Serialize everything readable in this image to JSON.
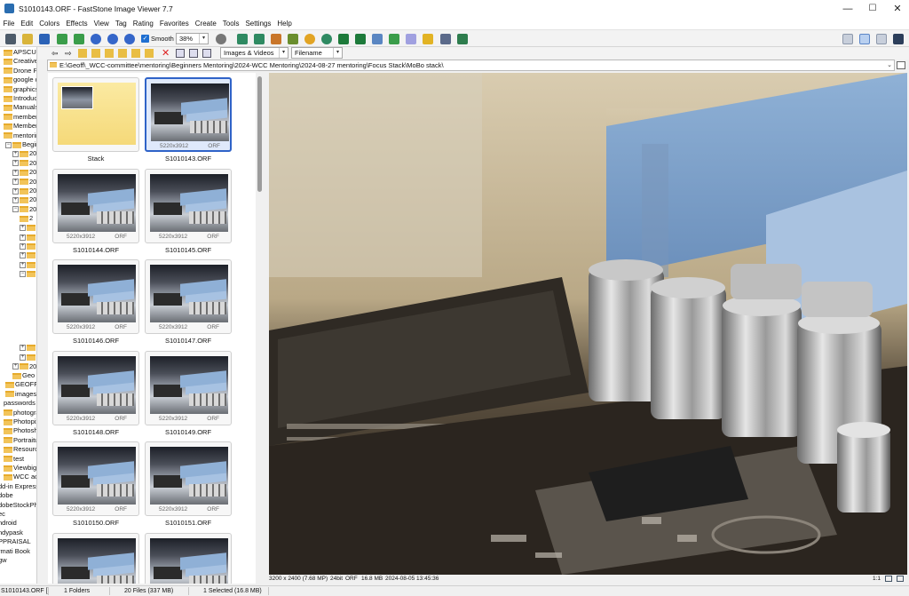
{
  "window": {
    "title": "S1010143.ORF  -  FastStone Image Viewer 7.7",
    "controls": [
      "—",
      "☐",
      "✕"
    ]
  },
  "menu": [
    "File",
    "Edit",
    "Colors",
    "Effects",
    "View",
    "Tag",
    "Rating",
    "Favorites",
    "Create",
    "Tools",
    "Settings",
    "Help"
  ],
  "toolbar": {
    "smooth_label": "Smooth",
    "zoom": "38%",
    "filter": "Images & Videos",
    "sort": "Filename"
  },
  "path": "E:\\Geoff\\_WCC-committee\\mentoring\\Beginners Mentoring\\2024-WCC Mentoring\\2024-08-27 mentoring\\Focus Stack\\MoBo stack\\",
  "tree": [
    {
      "label": "APSCUP201",
      "depth": 0,
      "expander": "",
      "folder": true
    },
    {
      "label": "Creative - C",
      "depth": 0,
      "expander": "",
      "folder": true
    },
    {
      "label": "Drone Perm",
      "depth": 0,
      "expander": "",
      "folder": true
    },
    {
      "label": "google driv",
      "depth": 0,
      "expander": "",
      "folder": true
    },
    {
      "label": "graphics",
      "depth": 0,
      "expander": "",
      "folder": true
    },
    {
      "label": "Introductor",
      "depth": 0,
      "expander": "",
      "folder": true
    },
    {
      "label": "Manuals an",
      "depth": 0,
      "expander": "",
      "folder": true
    },
    {
      "label": "membershi",
      "depth": 0,
      "expander": "",
      "folder": true
    },
    {
      "label": "Membershi",
      "depth": 0,
      "expander": "",
      "folder": true
    },
    {
      "label": "mentoring",
      "depth": 0,
      "expander": "",
      "folder": true
    },
    {
      "label": "Beginne",
      "depth": 1,
      "expander": "−",
      "folder": true
    },
    {
      "label": "2021",
      "depth": 2,
      "expander": "+",
      "folder": true
    },
    {
      "label": "2022",
      "depth": 2,
      "expander": "+",
      "folder": true
    },
    {
      "label": "2023",
      "depth": 2,
      "expander": "+",
      "folder": true
    },
    {
      "label": "2023",
      "depth": 2,
      "expander": "+",
      "folder": true
    },
    {
      "label": "2023",
      "depth": 2,
      "expander": "+",
      "folder": true
    },
    {
      "label": "2023",
      "depth": 2,
      "expander": "+",
      "folder": true
    },
    {
      "label": "2024",
      "depth": 2,
      "expander": "−",
      "folder": true
    },
    {
      "label": "2",
      "depth": 3,
      "expander": "",
      "folder": true
    },
    {
      "label": "2",
      "depth": 3,
      "expander": "+",
      "folder": true
    },
    {
      "label": "2",
      "depth": 3,
      "expander": "+",
      "folder": true
    },
    {
      "label": "2",
      "depth": 3,
      "expander": "+",
      "folder": true
    },
    {
      "label": "2",
      "depth": 3,
      "expander": "+",
      "folder": true
    },
    {
      "label": "2",
      "depth": 3,
      "expander": "+",
      "folder": true
    },
    {
      "label": "2",
      "depth": 3,
      "expander": "−",
      "folder": true
    },
    {
      "label": "",
      "depth": 4,
      "expander": "",
      "folder": false
    },
    {
      "label": "",
      "depth": 4,
      "expander": "",
      "folder": false
    },
    {
      "label": "",
      "depth": 4,
      "expander": "",
      "folder": false
    },
    {
      "label": "",
      "depth": 4,
      "expander": "",
      "folder": false
    },
    {
      "label": "",
      "depth": 4,
      "expander": "",
      "folder": false
    },
    {
      "label": "",
      "depth": 4,
      "expander": "",
      "folder": false
    },
    {
      "label": "",
      "depth": 4,
      "expander": "",
      "folder": false
    },
    {
      "label": "2",
      "depth": 3,
      "expander": "+",
      "folder": true
    },
    {
      "label": "2",
      "depth": 3,
      "expander": "+",
      "folder": true
    },
    {
      "label": "2025",
      "depth": 2,
      "expander": "+",
      "folder": true
    },
    {
      "label": "Geo",
      "depth": 2,
      "expander": "",
      "folder": true
    },
    {
      "label": "GEOFF I",
      "depth": 1,
      "expander": "",
      "folder": true
    },
    {
      "label": "images",
      "depth": 1,
      "expander": "",
      "folder": true
    },
    {
      "label": "passwords",
      "depth": 0,
      "expander": "",
      "folder": false
    },
    {
      "label": "photograph",
      "depth": 0,
      "expander": "",
      "folder": true
    },
    {
      "label": "Photopix",
      "depth": 0,
      "expander": "",
      "folder": true
    },
    {
      "label": "Photoshop",
      "depth": 0,
      "expander": "",
      "folder": true
    },
    {
      "label": "Portraiture",
      "depth": 0,
      "expander": "",
      "folder": true
    },
    {
      "label": "Resources.v",
      "depth": 0,
      "expander": "",
      "folder": true
    },
    {
      "label": "test",
      "depth": 0,
      "expander": "",
      "folder": true
    },
    {
      "label": "Viewbig cha",
      "depth": 0,
      "expander": "",
      "folder": true
    },
    {
      "label": "WCC activit",
      "depth": 0,
      "expander": "",
      "folder": true
    },
    {
      "label": "dd-in Express",
      "depth": -1,
      "expander": "",
      "folder": false
    },
    {
      "label": "dobe",
      "depth": -1,
      "expander": "",
      "folder": false
    },
    {
      "label": "dobeStockPh",
      "depth": -1,
      "expander": "",
      "folder": false
    },
    {
      "label": "ec",
      "depth": -1,
      "expander": "",
      "folder": false
    },
    {
      "label": "ndroid",
      "depth": -1,
      "expander": "",
      "folder": false
    },
    {
      "label": "ndypask",
      "depth": -1,
      "expander": "",
      "folder": false
    },
    {
      "label": "PPRAISAL",
      "depth": -1,
      "expander": "",
      "folder": false
    },
    {
      "label": "rmati Book",
      "depth": -1,
      "expander": "",
      "folder": false
    },
    {
      "label": "gw",
      "depth": -1,
      "expander": "",
      "folder": false
    }
  ],
  "thumbnails": [
    {
      "name": "Stack",
      "dims": "",
      "ext": "",
      "stack": true,
      "selected": false
    },
    {
      "name": "S1010143.ORF",
      "dims": "5220x3912",
      "ext": "ORF",
      "stack": false,
      "selected": true
    },
    {
      "name": "S1010144.ORF",
      "dims": "5220x3912",
      "ext": "ORF",
      "stack": false,
      "selected": false
    },
    {
      "name": "S1010145.ORF",
      "dims": "5220x3912",
      "ext": "ORF",
      "stack": false,
      "selected": false
    },
    {
      "name": "S1010146.ORF",
      "dims": "5220x3912",
      "ext": "ORF",
      "stack": false,
      "selected": false
    },
    {
      "name": "S1010147.ORF",
      "dims": "5220x3912",
      "ext": "ORF",
      "stack": false,
      "selected": false
    },
    {
      "name": "S1010148.ORF",
      "dims": "5220x3912",
      "ext": "ORF",
      "stack": false,
      "selected": false
    },
    {
      "name": "S1010149.ORF",
      "dims": "5220x3912",
      "ext": "ORF",
      "stack": false,
      "selected": false
    },
    {
      "name": "S1010150.ORF",
      "dims": "5220x3912",
      "ext": "ORF",
      "stack": false,
      "selected": false
    },
    {
      "name": "S1010151.ORF",
      "dims": "5220x3912",
      "ext": "ORF",
      "stack": false,
      "selected": false
    },
    {
      "name": "",
      "dims": "",
      "ext": "",
      "stack": false,
      "selected": false
    },
    {
      "name": "",
      "dims": "",
      "ext": "",
      "stack": false,
      "selected": false
    }
  ],
  "image_info": {
    "dimensions": "3200 x 2400 (7.68 MP)",
    "bitdepth": "24bit",
    "format": "ORF",
    "size": "16.8 MB",
    "date": "2024-08-05 13:45:36",
    "zoom": "1:1"
  },
  "status": {
    "file": "S1010143.ORF [",
    "folders": "1 Folders",
    "files": "20 Files (337 MB)",
    "selected": "1 Selected (16.8 MB)"
  },
  "colors": {
    "selection": "#2f63c8",
    "accent": "#1f6fd1"
  }
}
